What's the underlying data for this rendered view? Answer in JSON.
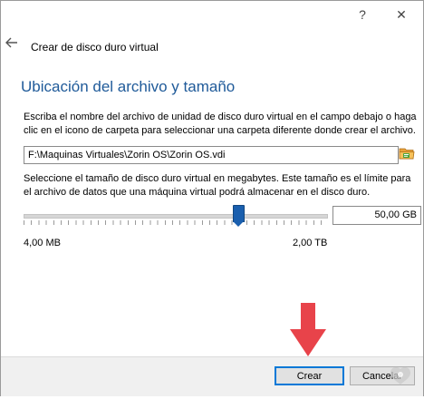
{
  "window": {
    "help_label": "?",
    "close_label": "✕"
  },
  "wizard": {
    "back_icon": "left-arrow-icon",
    "title": "Crear de disco duro virtual",
    "heading": "Ubicación del archivo y tamaño",
    "description": "Escriba el nombre del archivo de unidad de disco duro virtual en el campo debajo o haga clic en el icono de carpeta para seleccionar una carpeta diferente donde crear el archivo.",
    "file_path": "F:\\Maquinas Virtuales\\Zorin OS\\Zorin OS.vdi",
    "folder_icon": "folder-icon",
    "size_description": "Seleccione el tamaño de disco duro virtual en megabytes. Este tamaño es el límite para el archivo de datos que una máquina virtual podrá almacenar en el disco duro.",
    "size_value": "50,00 GB",
    "slider_fraction": 0.71,
    "min_label": "4,00 MB",
    "max_label": "2,00 TB"
  },
  "footer": {
    "create_label": "Crear",
    "cancel_label": "Cancelar"
  },
  "annotation": {
    "arrow_color": "#e8434a",
    "arrow_icon": "down-arrow-icon"
  },
  "colors": {
    "heading": "#1f5a99",
    "slider_thumb": "#1a5fae",
    "default_button_border": "#0078d7"
  }
}
